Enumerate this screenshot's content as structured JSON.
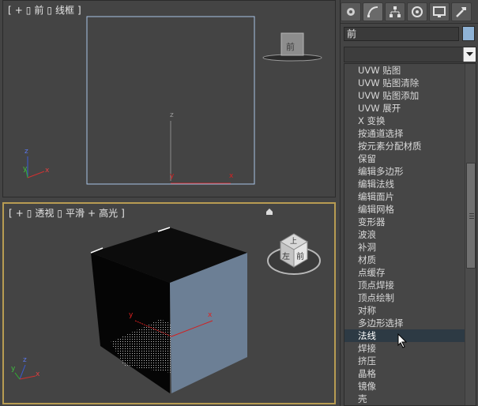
{
  "viewports": {
    "front": {
      "label_parts": [
        "[",
        "+",
        "▯",
        "前",
        "▯",
        "线框",
        "]"
      ],
      "axis_z": "z",
      "axis_y": "y",
      "axis_x": "x",
      "gizmo_y": "y",
      "gizmo_x": "x",
      "gizmo_z": "z",
      "cube_face": "前"
    },
    "perspective": {
      "label_parts": [
        "[",
        "+",
        "▯",
        "透视",
        "▯",
        "平滑",
        "+",
        "高光",
        "]"
      ],
      "axis_y": "y",
      "axis_x": "x",
      "gizmo_y": "y",
      "gizmo_x": "x",
      "gizmo_z": "z",
      "cube_top": "上",
      "cube_left": "左",
      "cube_front": "前"
    }
  },
  "command_panel": {
    "tabs": [
      "create-icon",
      "modify-icon",
      "hierarchy-icon",
      "motion-icon",
      "display-icon",
      "utilities-icon"
    ],
    "object_name": "前",
    "object_color": "#8fb3d6",
    "modifier_dropdown_value": "",
    "modifier_list": [
      "UVW 贴图",
      "UVW 贴图清除",
      "UVW 贴图添加",
      "UVW 展开",
      "X 变换",
      "按通道选择",
      "按元素分配材质",
      "保留",
      "编辑多边形",
      "编辑法线",
      "编辑面片",
      "编辑网格",
      "变形器",
      "波浪",
      "补洞",
      "材质",
      "点缓存",
      "顶点焊接",
      "顶点绘制",
      "对称",
      "多边形选择",
      "法线",
      "焊接",
      "挤压",
      "晶格",
      "镜像",
      "壳"
    ],
    "selected_index": 21,
    "scroll_position": 0.42
  }
}
